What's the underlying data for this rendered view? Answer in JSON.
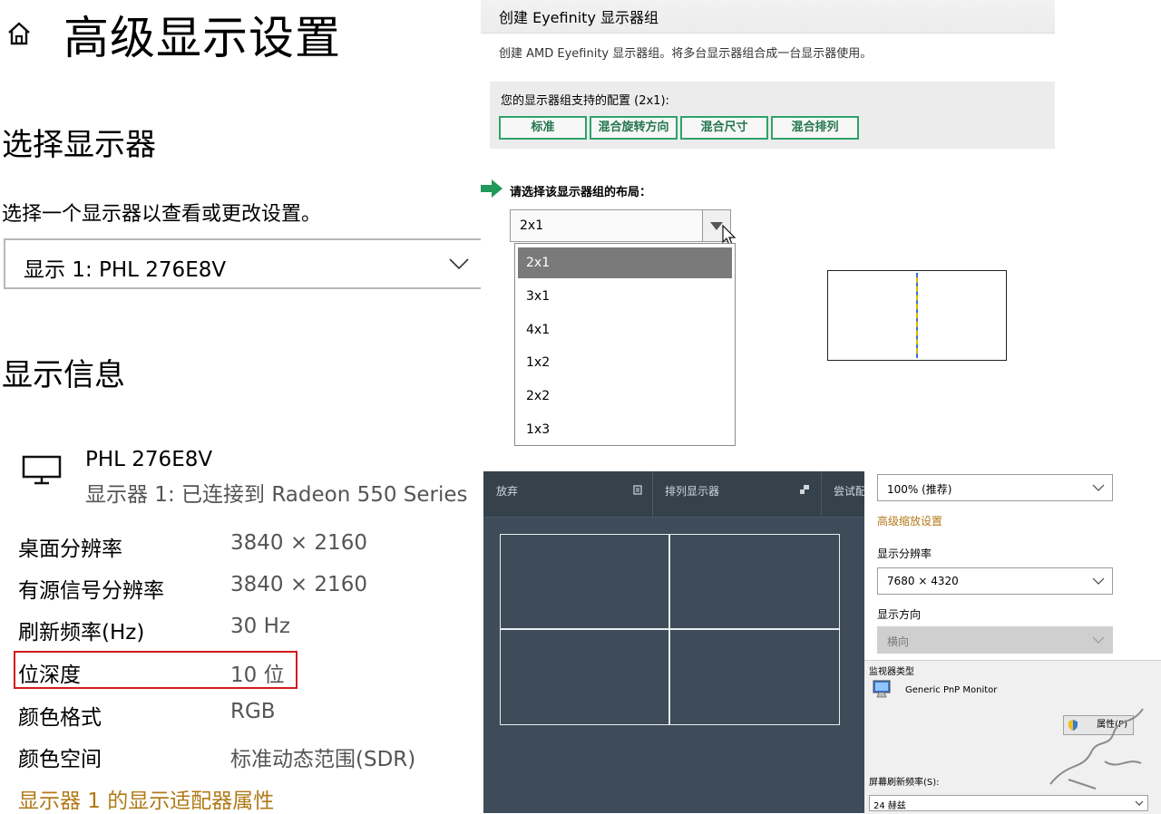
{
  "left": {
    "title": "高级显示设置",
    "select_section": "选择显示器",
    "select_hint": "选择一个显示器以查看或更改设置。",
    "selected_monitor": "显示 1: PHL 276E8V",
    "info_section": "显示信息",
    "monitor_name": "PHL 276E8V",
    "monitor_sub": "显示器 1: 已连接到 Radeon 550 Series",
    "rows": [
      {
        "label": "桌面分辨率",
        "value": "3840 × 2160"
      },
      {
        "label": "有源信号分辨率",
        "value": "3840 × 2160"
      },
      {
        "label": "刷新频率(Hz)",
        "value": "30 Hz"
      },
      {
        "label": "位深度",
        "value": "10 位"
      },
      {
        "label": "颜色格式",
        "value": "RGB"
      },
      {
        "label": "颜色空间",
        "value": "标准动态范围(SDR)"
      }
    ],
    "adapter_link": "显示器 1 的显示适配器属性"
  },
  "eyefinity": {
    "title": "创建 Eyefinity 显示器组",
    "description": "创建 AMD Eyefinity 显示器组。将多台显示器组合成一台显示器使用。",
    "config_label": "您的显示器组支持的配置 (2x1):",
    "config_buttons": [
      "标准",
      "混合旋转方向",
      "混合尺寸",
      "混合排列"
    ],
    "layout_label": "请选择该显示器组的布局：",
    "layout_value": "2x1",
    "layout_options": [
      "2x1",
      "3x1",
      "4x1",
      "1x2",
      "2x2",
      "1x3"
    ],
    "colors": {
      "accent": "#2ea36b"
    }
  },
  "arrange": {
    "discard_label": "放弃",
    "arrange_label": "排列显示器",
    "try_label": "尝试配"
  },
  "scaling": {
    "scale_value": "100% (推荐)",
    "advanced_scale_link": "高级缩放设置",
    "resolution_label": "显示分辨率",
    "resolution_value": "7680 × 4320",
    "orientation_label": "显示方向",
    "orientation_value": "横向"
  },
  "classic": {
    "monitor_type_label": "监视器类型",
    "monitor_type_value": "Generic PnP Monitor",
    "properties_button": "属性(P)",
    "refresh_label": "屏幕刷新频率(S):",
    "refresh_value": "24 赫兹"
  }
}
